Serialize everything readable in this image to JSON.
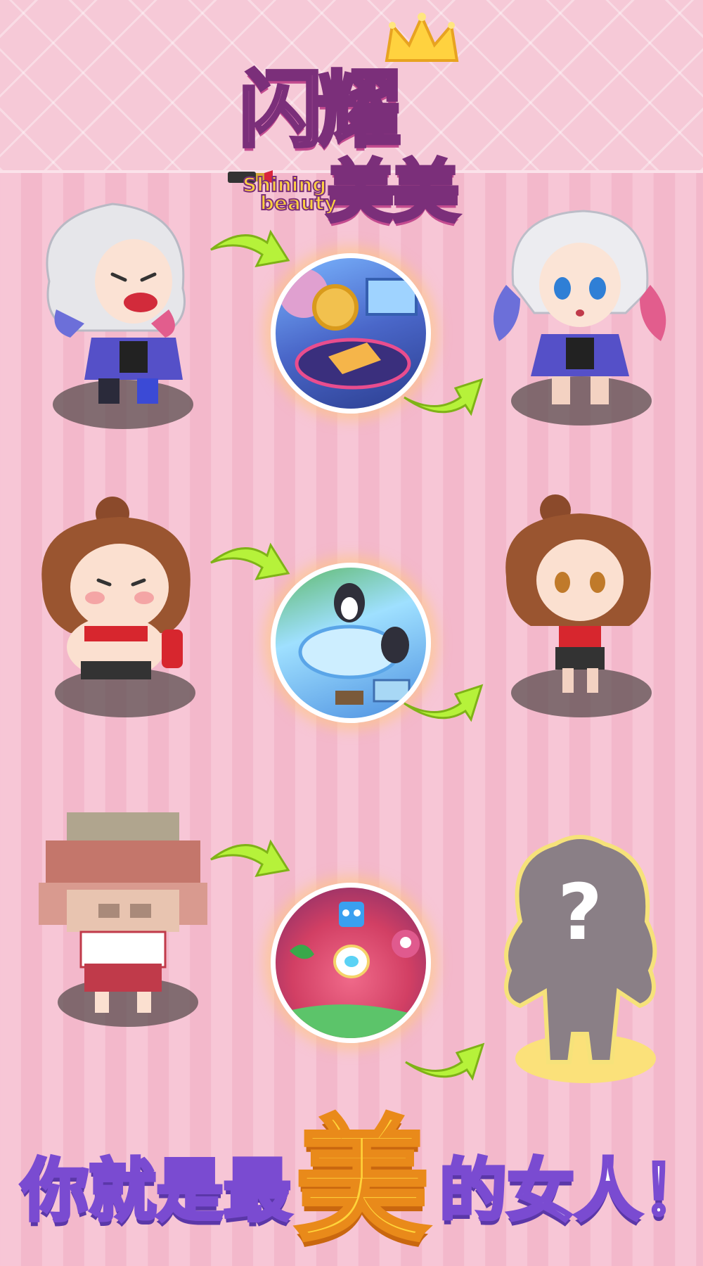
{
  "logo": {
    "title_line1": "闪耀",
    "title_line2": "美美",
    "subtitle_line1": "Shining",
    "subtitle_line2": "beauty"
  },
  "rows": [
    {
      "before": "silver-hair-girl-messy",
      "scene": "beauty-salon-scene",
      "after": "silver-hair-girl-styled"
    },
    {
      "before": "brown-hair-girl-chubby",
      "scene": "penguin-ice-scene",
      "after": "brown-hair-girl-slim"
    },
    {
      "before": "pixelated-girl",
      "scene": "monster-planet-scene",
      "after": "mystery-silhouette"
    }
  ],
  "mystery_mark": "?",
  "slogan": {
    "left": "你就是最",
    "highlight": "美",
    "right": "的女人！"
  },
  "colors": {
    "stripe_light": "#f7c6d6",
    "stripe_dark": "#f3b8cb",
    "arrow_green": "#b6f23a",
    "slogan_outline": "#7a4bd1",
    "highlight_yellow": "#ffd43a"
  }
}
